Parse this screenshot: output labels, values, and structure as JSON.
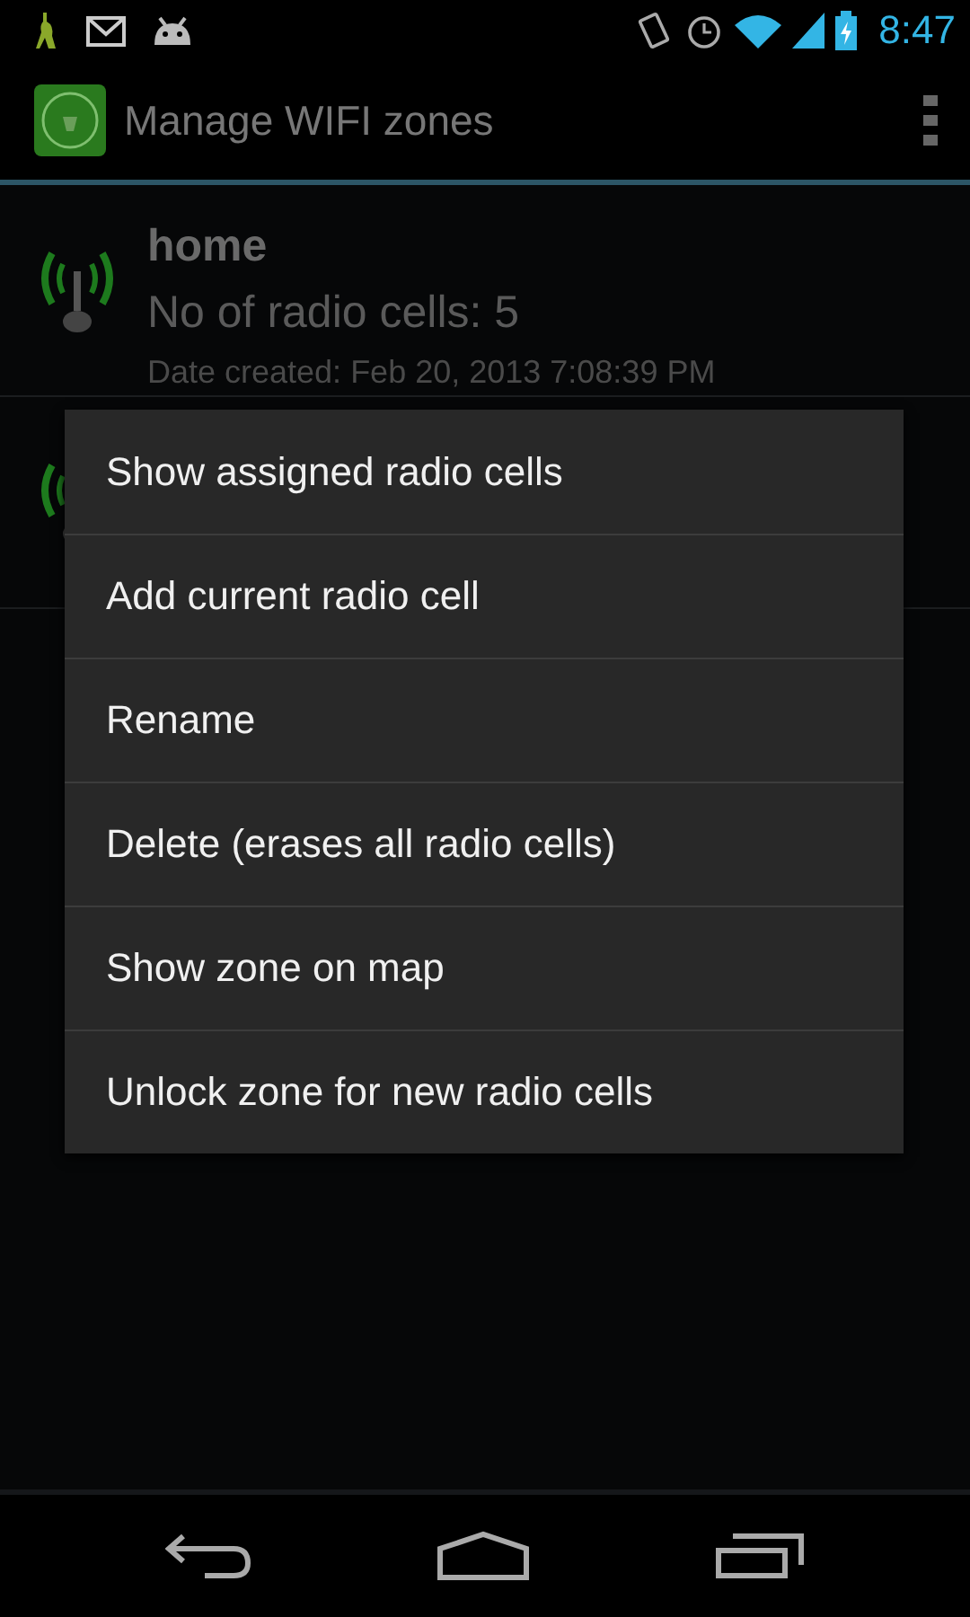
{
  "status_bar": {
    "time": "8:47"
  },
  "action_bar": {
    "title": "Manage WIFI zones"
  },
  "zones": [
    {
      "kind": "zone",
      "name": "home",
      "cells": "No of radio cells: 5",
      "created": "Date created: Feb 20, 2013 7:08:39 PM"
    },
    {
      "kind": "covered"
    }
  ],
  "context_menu": [
    "Show assigned radio cells",
    "Add current radio cell",
    "Rename",
    "Delete (erases all radio cells)",
    "Show zone on map",
    "Unlock zone for new radio cells"
  ]
}
